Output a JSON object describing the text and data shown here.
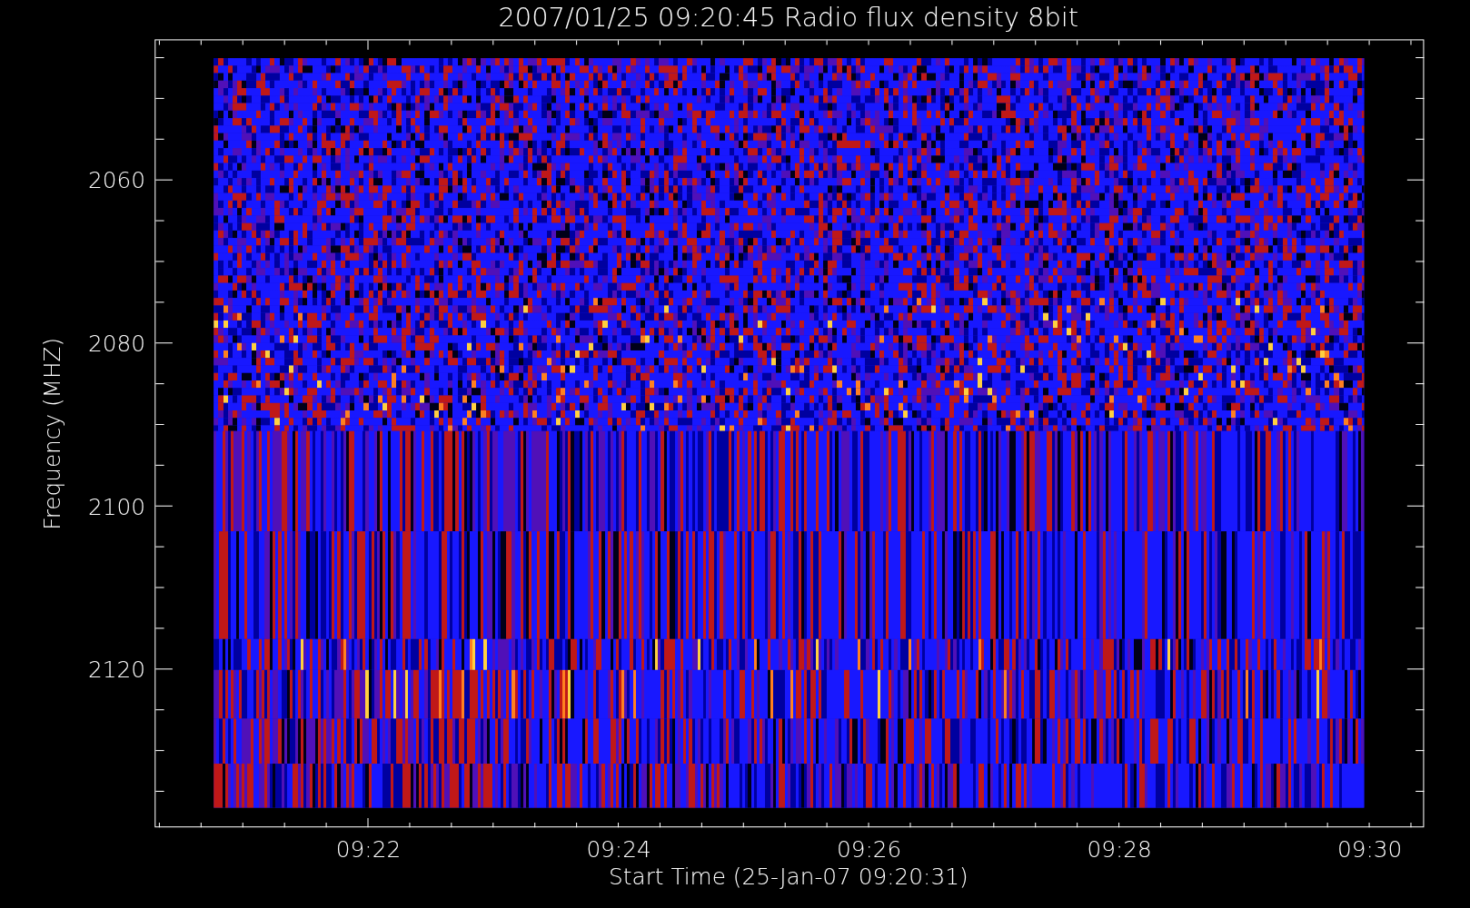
{
  "title": "2007/01/25 09:20:45 Radio flux density 8bit",
  "xlabel": "Start Time (25-Jan-07 09:20:31)",
  "ylabel": "Frequency (MHZ)",
  "xticks": [
    "09:22",
    "09:24",
    "09:26",
    "09:28",
    "09:30"
  ],
  "yticks": [
    "2060",
    "2080",
    "2100",
    "2120"
  ]
}
